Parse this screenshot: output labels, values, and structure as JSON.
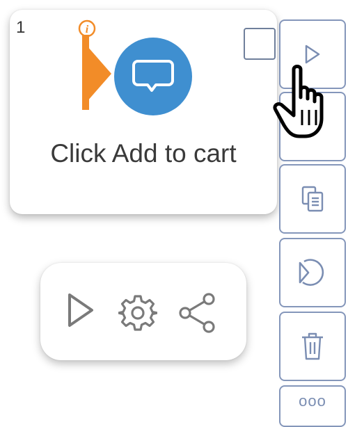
{
  "step_card": {
    "number": "1",
    "label": "Click Add to cart",
    "info_icon": "info-icon",
    "action_icon": "speech-bubble-icon"
  },
  "action_bar": {
    "icons": [
      "play-icon",
      "gear-icon",
      "share-icon"
    ]
  },
  "toolbar": {
    "buttons": [
      "play-icon",
      "insert-icon",
      "copy-icon",
      "loop-icon",
      "trash-icon",
      "more-icon"
    ],
    "more_label": "ooo"
  },
  "colors": {
    "accent_blue": "#3f8fd0",
    "flag_orange": "#f28c28",
    "icon_gray": "#7a7a7a",
    "tool_border": "#8496ba"
  }
}
